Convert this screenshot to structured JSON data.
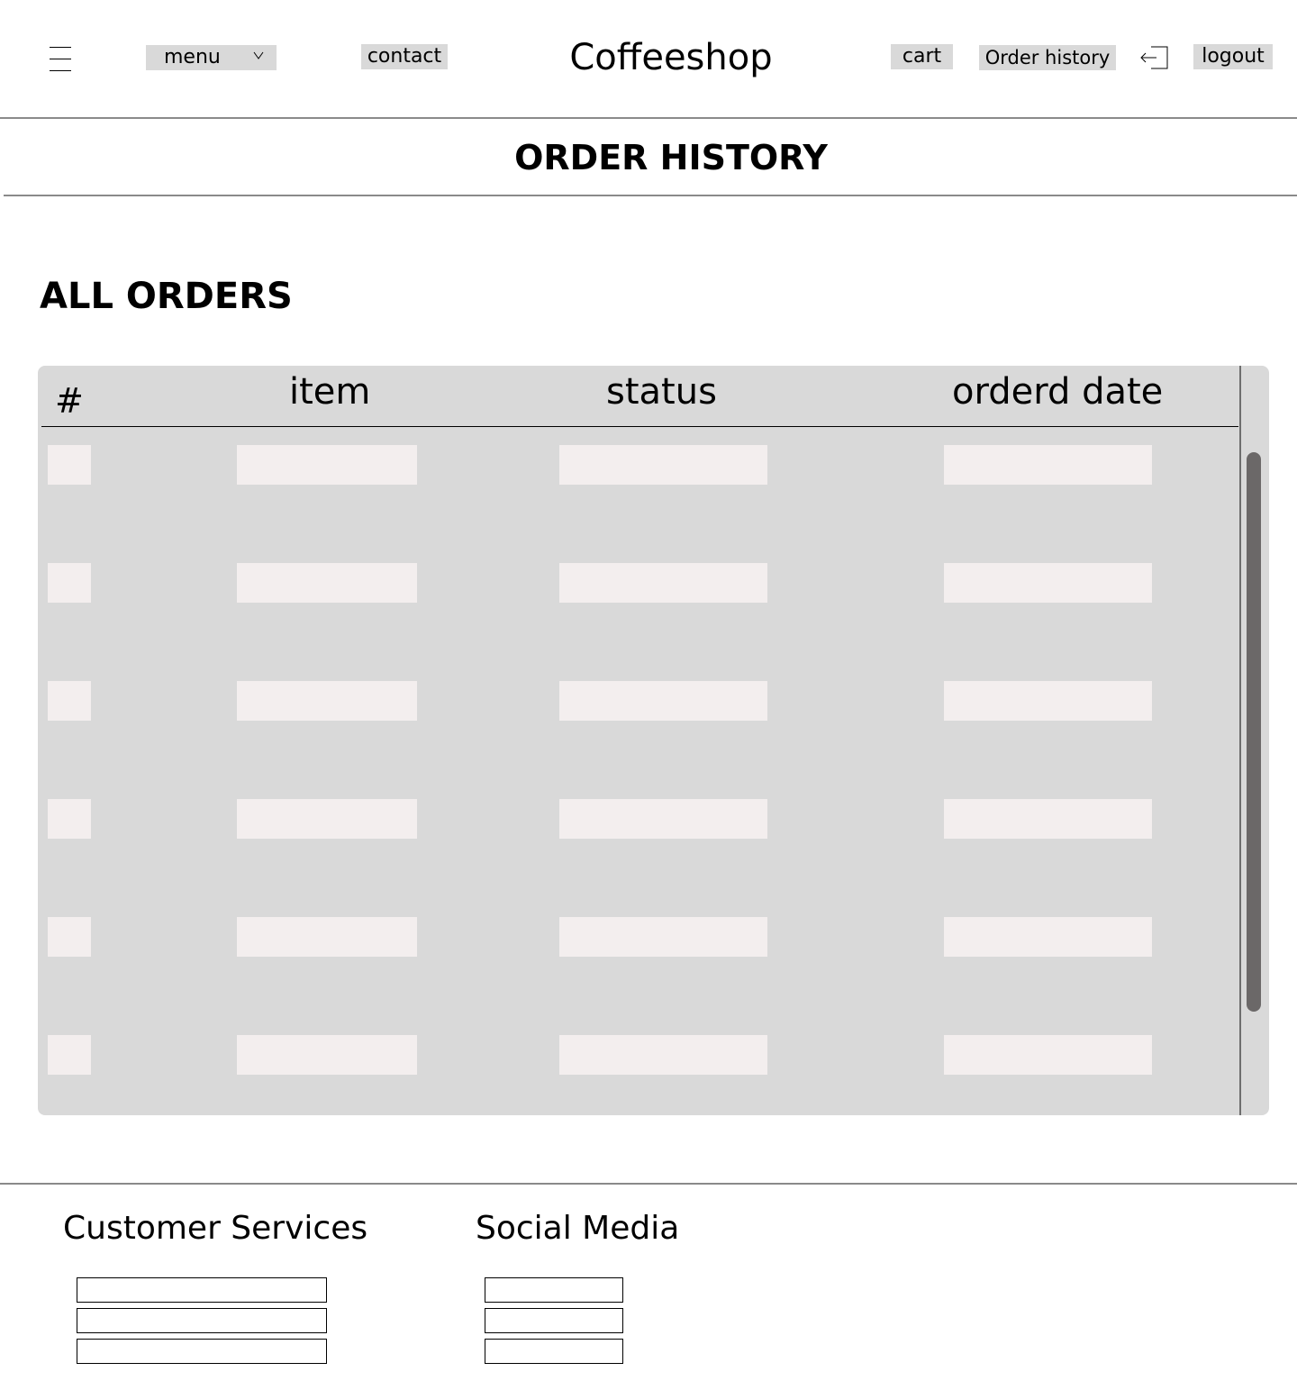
{
  "header": {
    "brand": "Coffeeshop",
    "nav": {
      "menu_label": "menu",
      "contact_label": "contact",
      "cart_label": "cart",
      "order_history_label": "Order history",
      "logout_label": "logout"
    },
    "icons": {
      "hamburger": "hamburger-menu-icon",
      "menu_dropdown": "chevron-down-icon",
      "logout": "logout-icon"
    }
  },
  "page": {
    "title": "ORDER HISTORY",
    "section_title": "ALL ORDERS"
  },
  "orders_table": {
    "columns": [
      "#",
      "item",
      "status",
      "orderd date"
    ],
    "rows": [
      {
        "num": "",
        "item": "",
        "status": "",
        "date": ""
      },
      {
        "num": "",
        "item": "",
        "status": "",
        "date": ""
      },
      {
        "num": "",
        "item": "",
        "status": "",
        "date": ""
      },
      {
        "num": "",
        "item": "",
        "status": "",
        "date": ""
      },
      {
        "num": "",
        "item": "",
        "status": "",
        "date": ""
      },
      {
        "num": "",
        "item": "",
        "status": "",
        "date": ""
      }
    ]
  },
  "footer": {
    "customer_services_title": "Customer Services",
    "social_media_title": "Social Media",
    "customer_services_links": [
      "",
      "",
      ""
    ],
    "social_media_links": [
      "",
      "",
      ""
    ]
  },
  "colors": {
    "nav_button_bg": "#d9d9d9",
    "table_bg": "#d9d9d9",
    "cell_placeholder": "#f3eeee",
    "scrollbar": "#6b6868",
    "rule": "#8a8a8a"
  }
}
